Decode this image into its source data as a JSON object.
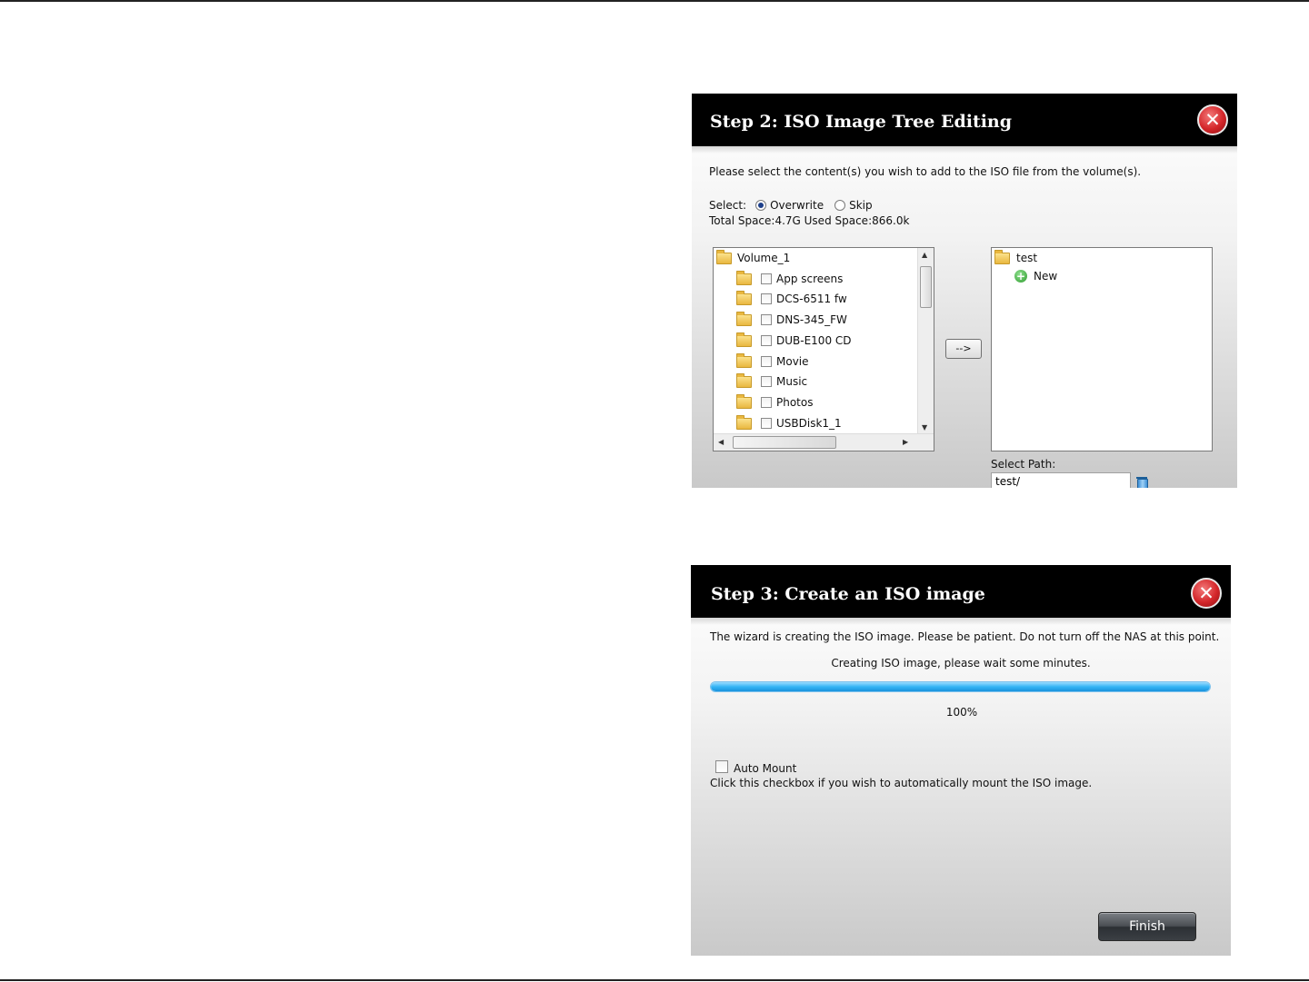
{
  "step2": {
    "title": "Step 2: ISO Image Tree Editing",
    "close_symbol": "✕",
    "instruction": "Please select the content(s) you wish to add to the ISO file from the volume(s).",
    "select_label": "Select:",
    "options": [
      {
        "label": "Overwrite",
        "selected": true
      },
      {
        "label": "Skip",
        "selected": false
      }
    ],
    "space_info": "Total Space:4.7G Used Space:866.0k",
    "source_tree": {
      "root": "Volume_1",
      "items": [
        "App screens",
        "DCS-6511 fw",
        "DNS-345_FW",
        "DUB-E100 CD",
        "Movie",
        "Music",
        "Photos",
        "USBDisk1_1"
      ]
    },
    "move_button": "-->",
    "target_tree": {
      "root": "test",
      "new_label": "New"
    },
    "select_path_label": "Select Path:",
    "select_path_value": "test/"
  },
  "step3": {
    "title": "Step 3: Create an ISO image",
    "close_symbol": "✕",
    "notice": "The wizard is creating the ISO image. Please be patient. Do not turn off the NAS at this point.",
    "status": "Creating ISO image, please wait some minutes.",
    "progress_percent": 100,
    "progress_text": "100%",
    "auto_mount": {
      "label": "Auto Mount",
      "checked": false
    },
    "auto_mount_help": "Click this checkbox if you wish to automatically mount the ISO image.",
    "finish_label": "Finish"
  },
  "colors": {
    "header_bg": "#000000",
    "close_red": "#d4262a",
    "progress_blue": "#35b4f5"
  }
}
